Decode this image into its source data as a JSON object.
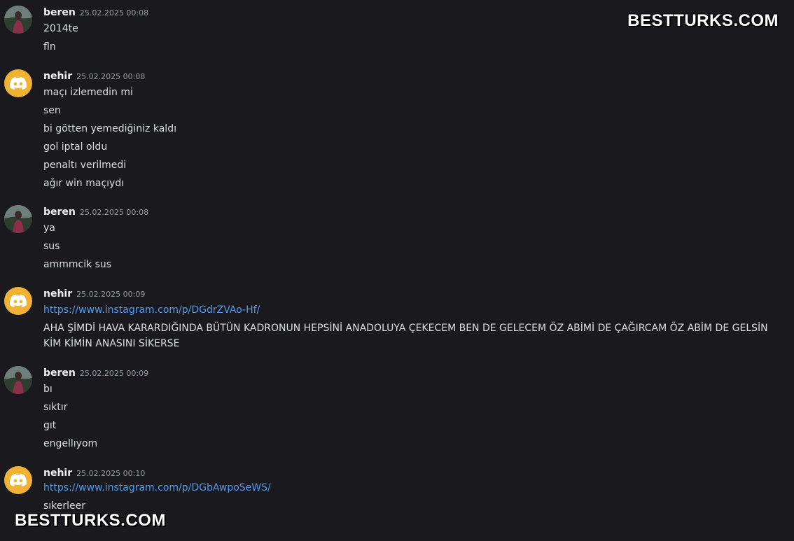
{
  "watermark": {
    "top": "BESTTURKS.COM",
    "bottom": "BESTTURKS.COM"
  },
  "colors": {
    "background": "#1a1a1e",
    "link": "#4f9bf0",
    "discord_avatar": "#f0b232"
  },
  "messages": [
    {
      "user": "beren",
      "time": "25.02.2025 00:08",
      "avatar": "photo",
      "lines": [
        "2014te",
        "fln"
      ]
    },
    {
      "user": "nehir",
      "time": "25.02.2025 00:08",
      "avatar": "discord-icon",
      "lines": [
        "maçı izlemedin mi",
        "sen",
        "bi götten yemediğiniz kaldı",
        "gol iptal oldu",
        "penaltı verilmedi",
        "ağır win maçıydı"
      ]
    },
    {
      "user": "beren",
      "time": "25.02.2025 00:08",
      "avatar": "photo",
      "lines": [
        "ya",
        "sus",
        "ammmcik sus"
      ]
    },
    {
      "user": "nehir",
      "time": "25.02.2025 00:09",
      "avatar": "discord-icon",
      "link": "https://www.instagram.com/p/DGdrZVAo-Hf/",
      "text": "AHA ŞİMDİ HAVA KARARDIĞINDA BÜTÜN KADRONUN HEPSİNİ ANADOLUYA ÇEKECEM BEN DE GELECEM ÖZ ABİMİ DE ÇAĞIRCAM ÖZ ABİM DE GELSİN KİM KİMİN ANASINI SİKERSE"
    },
    {
      "user": "beren",
      "time": "25.02.2025 00:09",
      "avatar": "photo",
      "lines": [
        "bı",
        "sıktır",
        "gıt",
        "engellıyom"
      ]
    },
    {
      "user": "nehir",
      "time": "25.02.2025 00:10",
      "avatar": "discord-icon",
      "link": "https://www.instagram.com/p/DGbAwpoSeWS/",
      "lines": [
        "sıkerleer"
      ]
    }
  ]
}
